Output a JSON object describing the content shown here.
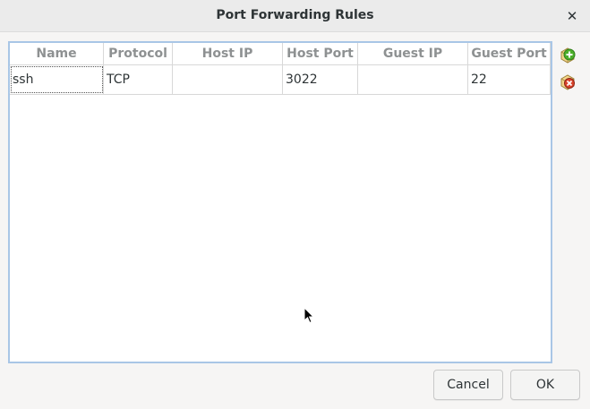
{
  "window": {
    "title": "Port Forwarding Rules",
    "close_glyph": "✕"
  },
  "table": {
    "columns": [
      "Name",
      "Protocol",
      "Host IP",
      "Host Port",
      "Guest IP",
      "Guest Port"
    ],
    "rows": [
      {
        "name": "ssh",
        "protocol": "TCP",
        "host_ip": "",
        "host_port": "3022",
        "guest_ip": "",
        "guest_port": "22"
      }
    ]
  },
  "side_actions": {
    "add_icon": "add-rule-icon",
    "remove_icon": "remove-rule-icon"
  },
  "buttons": {
    "cancel_label": "Cancel",
    "ok_label": "OK"
  },
  "colors": {
    "table_border": "#a9c6e6",
    "add_green": "#4caf2a",
    "remove_red": "#d9432b"
  }
}
